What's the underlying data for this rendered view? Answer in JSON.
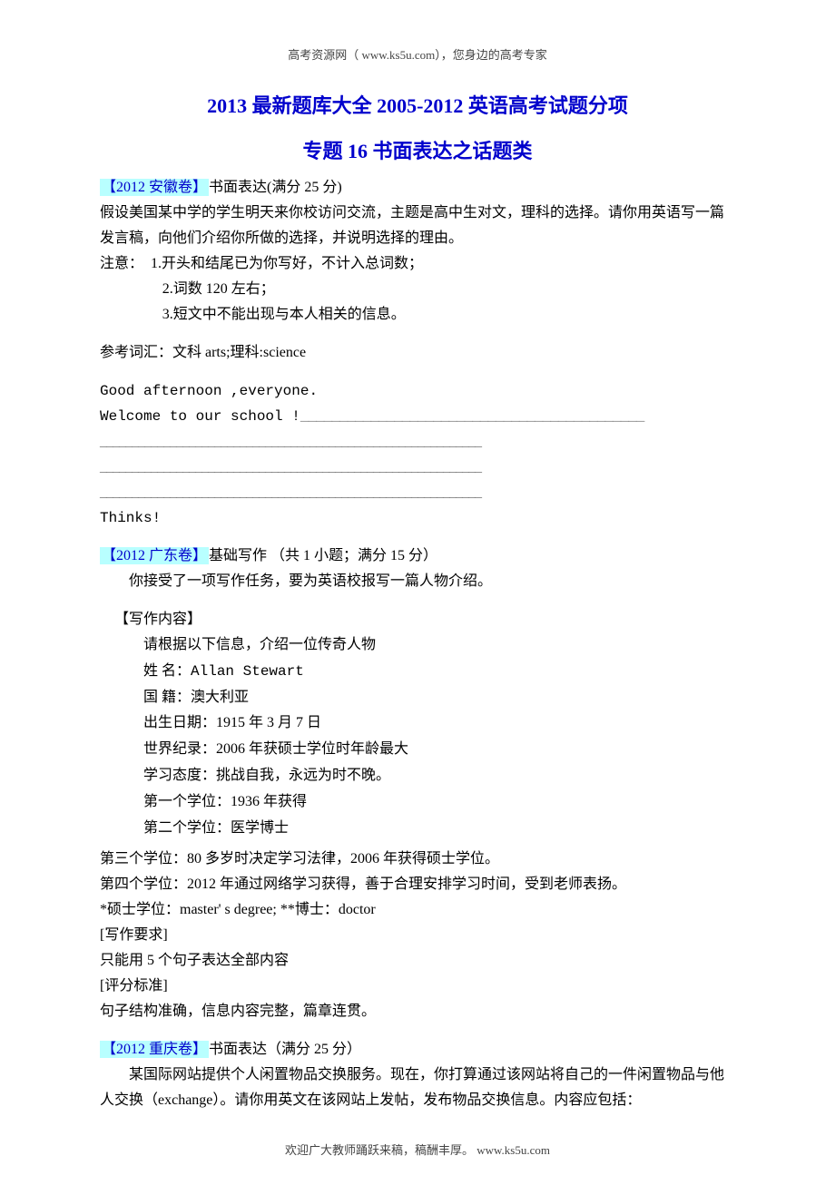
{
  "header": "高考资源网（ www.ks5u.com），您身边的高考专家",
  "title_line1": "2013 最新题库大全 2005-2012 英语高考试题分项",
  "title_line2": "专题 16  书面表达之话题类",
  "anhui": {
    "tag": "【2012 安徽卷】",
    "head": "书面表达(满分 25 分)",
    "p1": "假设美国某中学的学生明天来你校访问交流，主题是高中生对文，理科的选择。请你用英语写一篇发言稿，向他们介绍你所做的选择，并说明选择的理由。",
    "note_label": "注意：",
    "note1": "1.开头和结尾已为你写好，不计入总词数；",
    "note2": "2.词数 120 左右；",
    "note3": "3.短文中不能出现与本人相关的信息。",
    "ref": "参考词汇：文科 arts;理科:science",
    "line1": "Good afternoon ,everyone.",
    "line2": "Welcome to our school !",
    "blank": "____________________________________________________________",
    "thanks": "Thinks!"
  },
  "guangdong": {
    "tag": "【2012 广东卷】",
    "head": "基础写作 （共 1 小题；满分 15 分）",
    "intro": "你接受了一项写作任务，要为英语校报写一篇人物介绍。",
    "content_label": "【写作内容】",
    "content_intro": "请根据以下信息，介绍一位传奇人物",
    "rows": {
      "name_label": "姓  名：",
      "name_val": "Allan Stewart",
      "nat_label": "国  籍：",
      "nat_val": "澳大利亚",
      "dob_label": "出生日期：",
      "dob_val": "1915 年 3 月 7 日",
      "rec_label": "世界纪录：",
      "rec_val": "2006 年获硕士学位时年龄最大",
      "att_label": "学习态度：",
      "att_val": "挑战自我，永远为时不晚。",
      "d1_label": "第一个学位：",
      "d1_val": "1936 年获得",
      "d2_label": "第二个学位：",
      "d2_val": "医学博士"
    },
    "d3": "第三个学位：80 多岁时决定学习法律，2006 年获得硕士学位。",
    "d4": "第四个学位：2012 年通过网络学习获得，善于合理安排学习时间，受到老师表扬。",
    "gloss": "*硕士学位：master' s degree;   **博士：doctor",
    "req_label": "[写作要求]",
    "req": "只能用 5 个句子表达全部内容",
    "score_label": "[评分标准]",
    "score": "句子结构准确，信息内容完整，篇章连贯。"
  },
  "chongqing": {
    "tag": "【2012 重庆卷】",
    "head": "书面表达（满分 25 分）",
    "p1": "某国际网站提供个人闲置物品交换服务。现在，你打算通过该网站将自己的一件闲置物品与他人交换（exchange）。请你用英文在该网站上发帖，发布物品交换信息。内容应包括："
  },
  "footer": "欢迎广大教师踊跃来稿，稿酬丰厚。  www.ks5u.com"
}
